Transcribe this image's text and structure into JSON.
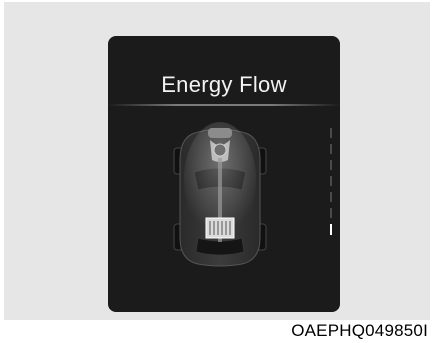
{
  "screen": {
    "title": "Energy Flow",
    "gauge": {
      "segment_count": 7,
      "active_segment": 7
    }
  },
  "caption": {
    "code": "OAEPHQ049850I"
  },
  "colors": {
    "screen_bg": "#1b1b1b",
    "frame_bg": "#e6e6e6",
    "text": "#f2f2f2"
  }
}
